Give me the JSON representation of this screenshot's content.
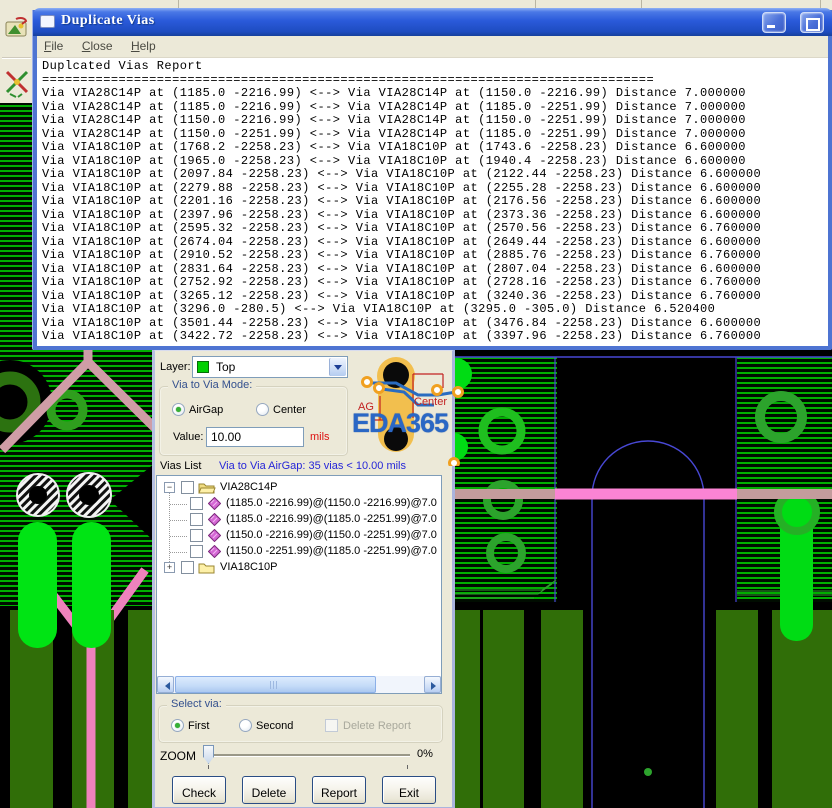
{
  "colors": {
    "titlebar_blue": "#2a5ada",
    "window_border": "#4e74d2",
    "dialog_bg": "#ece9d8",
    "pcb_stripe_green": "#00ae00",
    "pcb_bright_green": "#00dc14",
    "pcb_dark_green": "#306e08",
    "pcb_pink": "#fb84d4",
    "pcb_dusty_pink": "#cf9da6",
    "pcb_outline_blue": "#4848d4",
    "mils_red": "#dd1111",
    "info_blue": "#2626d8",
    "logo_blue": "#2a67c5",
    "swatch_green": "#00cf00"
  },
  "window": {
    "title": "Duplicate Vias",
    "menu": [
      "File",
      "Close",
      "Help"
    ],
    "report": {
      "title_line": "Duplcated Vias Report",
      "separator": "================================================================================",
      "lines": [
        "Via VIA28C14P at (1185.0 -2216.99) <--> Via VIA28C14P at (1150.0 -2216.99) Distance 7.000000",
        "Via VIA28C14P at (1185.0 -2216.99) <--> Via VIA28C14P at (1185.0 -2251.99) Distance 7.000000",
        "Via VIA28C14P at (1150.0 -2216.99) <--> Via VIA28C14P at (1150.0 -2251.99) Distance 7.000000",
        "Via VIA28C14P at (1150.0 -2251.99) <--> Via VIA28C14P at (1185.0 -2251.99) Distance 7.000000",
        "Via VIA18C10P at (1768.2 -2258.23) <--> Via VIA18C10P at (1743.6 -2258.23) Distance 6.600000",
        "Via VIA18C10P at (1965.0 -2258.23) <--> Via VIA18C10P at (1940.4 -2258.23) Distance 6.600000",
        "Via VIA18C10P at (2097.84 -2258.23) <--> Via VIA18C10P at (2122.44 -2258.23) Distance 6.600000",
        "Via VIA18C10P at (2279.88 -2258.23) <--> Via VIA18C10P at (2255.28 -2258.23) Distance 6.600000",
        "Via VIA18C10P at (2201.16 -2258.23) <--> Via VIA18C10P at (2176.56 -2258.23) Distance 6.600000",
        "Via VIA18C10P at (2397.96 -2258.23) <--> Via VIA18C10P at (2373.36 -2258.23) Distance 6.600000",
        "Via VIA18C10P at (2595.32 -2258.23) <--> Via VIA18C10P at (2570.56 -2258.23) Distance 6.760000",
        "Via VIA18C10P at (2674.04 -2258.23) <--> Via VIA18C10P at (2649.44 -2258.23) Distance 6.600000",
        "Via VIA18C10P at (2910.52 -2258.23) <--> Via VIA18C10P at (2885.76 -2258.23) Distance 6.760000",
        "Via VIA18C10P at (2831.64 -2258.23) <--> Via VIA18C10P at (2807.04 -2258.23) Distance 6.600000",
        "Via VIA18C10P at (2752.92 -2258.23) <--> Via VIA18C10P at (2728.16 -2258.23) Distance 6.760000",
        "Via VIA18C10P at (3265.12 -2258.23) <--> Via VIA18C10P at (3240.36 -2258.23) Distance 6.760000",
        "Via VIA18C10P at (3296.0 -280.5) <--> Via VIA18C10P at (3295.0 -305.0) Distance 6.520400",
        "Via VIA18C10P at (3501.44 -2258.23) <--> Via VIA18C10P at (3476.84 -2258.23) Distance 6.600000",
        "Via VIA18C10P at (3422.72 -2258.23) <--> Via VIA18C10P at (3397.96 -2258.23) Distance 6.760000"
      ]
    }
  },
  "dialog": {
    "layer_label": "Layer:",
    "layer_value": "Top",
    "mode_group": {
      "title": "Via to Via Mode:",
      "radio_airgap": "AirGap",
      "radio_center": "Center",
      "value_label": "Value:",
      "value": "10.00",
      "unit": "mils"
    },
    "graphic": {
      "ag_label": "AG",
      "center_label": "Center",
      "logo": "EDA365"
    },
    "vias_list_label": "Vias List",
    "vias_list_info": "Via to Via AirGap: 35 vias < 10.00 mils",
    "tree": {
      "root1_label": "VIA28C14P",
      "root2_label": "VIA18C10P",
      "children": [
        "(1185.0 -2216.99)@(1150.0 -2216.99)@7.0",
        "(1185.0 -2216.99)@(1185.0 -2251.99)@7.0",
        "(1150.0 -2216.99)@(1150.0 -2251.99)@7.0",
        "(1150.0 -2251.99)@(1185.0 -2251.99)@7.0"
      ]
    },
    "select_group": {
      "title": "Select via:",
      "radio_first": "First",
      "radio_second": "Second",
      "checkbox_delete": "Delete Report"
    },
    "zoom_label": "ZOOM",
    "zoom_value": "0%",
    "buttons": [
      "Check",
      "Delete",
      "Report",
      "Exit"
    ]
  }
}
